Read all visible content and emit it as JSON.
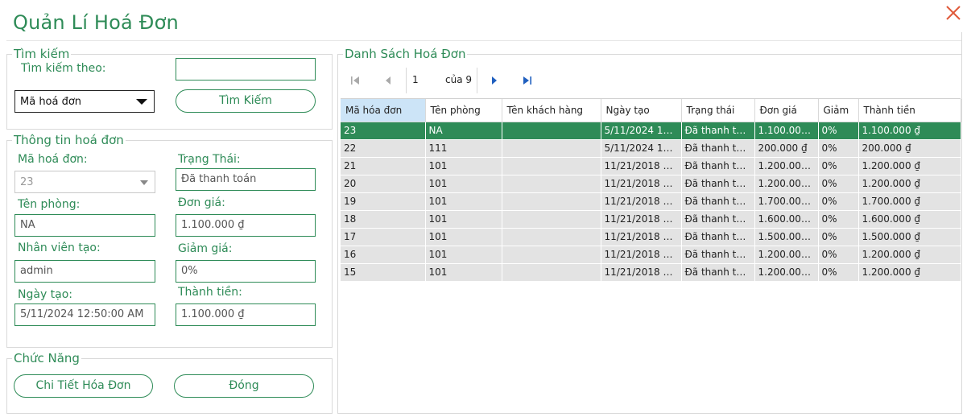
{
  "window": {
    "title": "Quản Lí Hoá Đơn"
  },
  "search": {
    "legend": "Tìm kiếm",
    "by_label": "Tìm kiếm theo:",
    "query_value": "",
    "field_selected": "Mã hoá đơn",
    "button": "Tìm Kiếm"
  },
  "info": {
    "legend": "Thông tin hoá đơn",
    "invoice_id_label": "Mã hoá đơn:",
    "invoice_id_value": "23",
    "status_label": "Trạng Thái:",
    "status_value": "Đã thanh toán",
    "room_label": "Tên phòng:",
    "room_value": "NA",
    "price_label": "Đơn giá:",
    "price_value": "1.100.000 ₫",
    "staff_label": "Nhân viên tạo:",
    "staff_value": "admin",
    "discount_label": "Giảm giá:",
    "discount_value": "0%",
    "date_label": "Ngày tạo:",
    "date_value": "5/11/2024 12:50:00 AM",
    "total_label": "Thành tiền:",
    "total_value": "1.100.000 ₫"
  },
  "functions": {
    "legend": "Chức Năng",
    "detail_button": "Chi Tiết Hóa Đơn",
    "close_button": "Đóng"
  },
  "list": {
    "legend": "Danh Sách Hoá Đơn",
    "page_current": "1",
    "page_of": "của 9",
    "columns": [
      "Mã hóa đơn",
      "Tên phòng",
      "Tên khách hàng",
      "Ngày tạo",
      "Trạng thái",
      "Đơn giá",
      "Giảm",
      "Thành tiền"
    ],
    "rows": [
      [
        "23",
        "NA",
        "",
        "5/11/2024 12:...",
        "Đã thanh toán",
        "1.100.000 ₫",
        "0%",
        "1.100.000 ₫"
      ],
      [
        "22",
        "111",
        "",
        "5/11/2024 12:...",
        "Đã thanh toán",
        "200.000 ₫",
        "0%",
        "200.000 ₫"
      ],
      [
        "21",
        "101",
        "",
        "11/21/2018 9:...",
        "Đã thanh toán",
        "1.200.000 ₫",
        "0%",
        "1.200.000 ₫"
      ],
      [
        "20",
        "101",
        "",
        "11/21/2018 9:...",
        "Đã thanh toán",
        "1.200.000 ₫",
        "0%",
        "1.200.000 ₫"
      ],
      [
        "19",
        "101",
        "",
        "11/21/2018 1...",
        "Đã thanh toán",
        "1.700.000 ₫",
        "0%",
        "1.700.000 ₫"
      ],
      [
        "18",
        "101",
        "",
        "11/21/2018 1...",
        "Đã thanh toán",
        "1.600.000 ₫",
        "0%",
        "1.600.000 ₫"
      ],
      [
        "17",
        "101",
        "",
        "11/21/2018 1...",
        "Đã thanh toán",
        "1.500.000 ₫",
        "0%",
        "1.500.000 ₫"
      ],
      [
        "16",
        "101",
        "",
        "11/21/2018 1...",
        "Đã thanh toán",
        "1.200.000 ₫",
        "0%",
        "1.200.000 ₫"
      ],
      [
        "15",
        "101",
        "",
        "11/21/2018 9:...",
        "Đã thanh toán",
        "1.200.000 ₫",
        "0%",
        "1.200.000 ₫"
      ]
    ],
    "selected_row": 0
  },
  "colors": {
    "accent": "#2e8b57",
    "close": "#e05a3a",
    "row_bg": "#e3e3e3",
    "header_active": "#cce4f7"
  },
  "icons": [
    "close-icon",
    "dropdown-arrow-icon",
    "first-page-icon",
    "prev-page-icon",
    "next-page-icon",
    "last-page-icon"
  ]
}
